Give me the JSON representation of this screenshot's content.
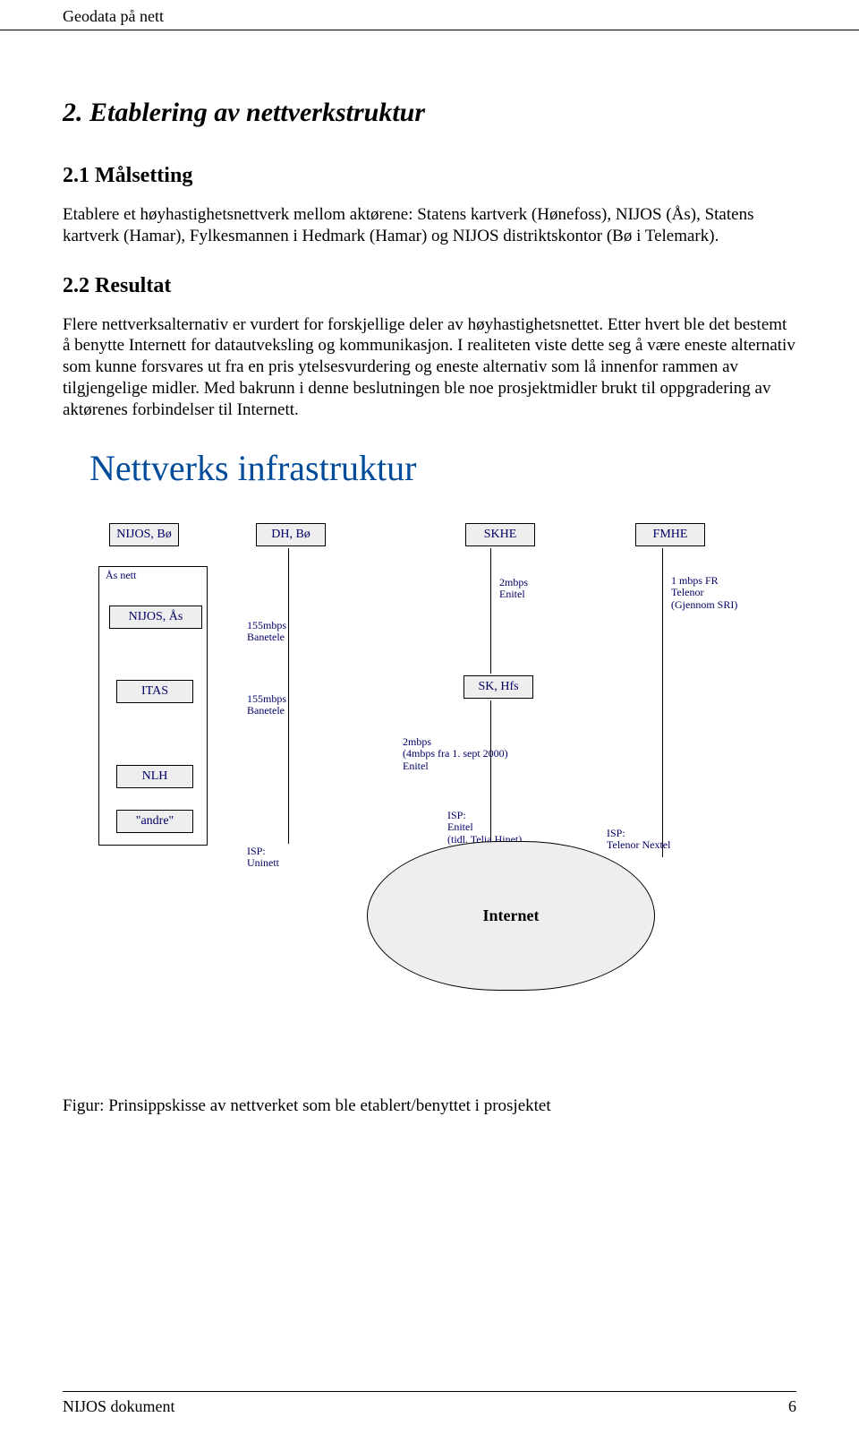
{
  "header": {
    "running_title": "Geodata på nett"
  },
  "section": {
    "title": "2. Etablering av nettverkstruktur",
    "sub1": {
      "heading": "2.1 Målsetting",
      "p1": "Etablere et høyhastighetsnettverk mellom aktørene: Statens kartverk (Hønefoss), NIJOS (Ås), Statens kartverk (Hamar), Fylkesmannen i Hedmark (Hamar) og NIJOS distriktskontor (Bø i Telemark)."
    },
    "sub2": {
      "heading": "2.2 Resultat",
      "p1": "Flere nettverksalternativ er vurdert for forskjellige deler av høyhastighetsnettet. Etter hvert ble det bestemt å benytte Internett for datautveksling og kommunikasjon. I realiteten viste dette seg å være eneste alternativ som kunne forsvares ut fra en pris ytelsesvurdering og eneste alternativ som lå innenfor rammen av tilgjengelige midler. Med bakrunn i denne beslutningen ble noe prosjektmidler brukt til oppgradering av aktørenes forbindelser til Internett."
    }
  },
  "diagram": {
    "title": "Nettverks infrastruktur",
    "nodes": {
      "nijos_bo": "NIJOS, Bø",
      "dh_bo": "DH, Bø",
      "skhe": "SKHE",
      "fmhe": "FMHE",
      "as_nett": "Ås nett",
      "nijos_as": "NIJOS, Ås",
      "itas": "ITAS",
      "nlh": "NLH",
      "andre": "\"andre\"",
      "sk_hfs": "SK, Hfs",
      "internet": "Internet"
    },
    "edge_labels": {
      "dh_link": "155mbps\nBanetele",
      "itas_link": "155mbps\nBanetele",
      "skhe_link": "2mbps\nEnitel",
      "skhfs_link": "2mbps\n(4mbps fra 1. sept 2000)\nEnitel",
      "fmhe_link": "1 mbps FR\nTelenor\n(Gjennom SRI)",
      "isp_uninett": "ISP:\nUninett",
      "isp_enitel": "ISP:\nEnitel\n(tidl. Telia Hinet)",
      "isp_telenor": "ISP:\nTelenor Nextel"
    },
    "caption": "Figur: Prinsippskisse av nettverket som ble etablert/benyttet i prosjektet"
  },
  "footer": {
    "doc": "NIJOS dokument",
    "page": "6"
  }
}
